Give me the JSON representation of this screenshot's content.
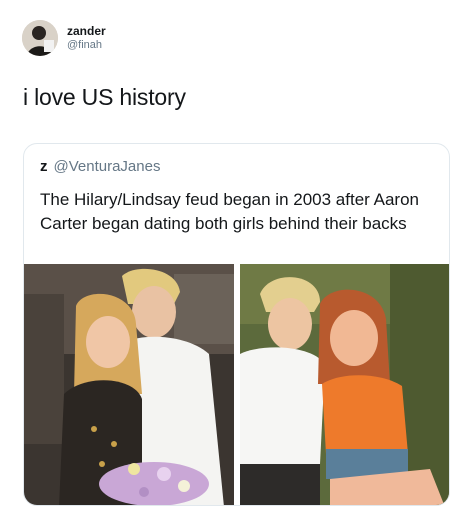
{
  "tweet": {
    "author_name": "zander",
    "author_handle": "@finah",
    "text": "i love US history"
  },
  "quoted_tweet": {
    "author_name": "z",
    "author_handle": "@VenturaJanes",
    "text": "The Hilary/Lindsay feud began in 2003 after Aaron Carter began dating both girls behind their backs"
  },
  "icons": {
    "avatar": "profile-avatar",
    "photo_left": "couple-photo-flowers",
    "photo_right": "couple-photo-orange-top"
  }
}
